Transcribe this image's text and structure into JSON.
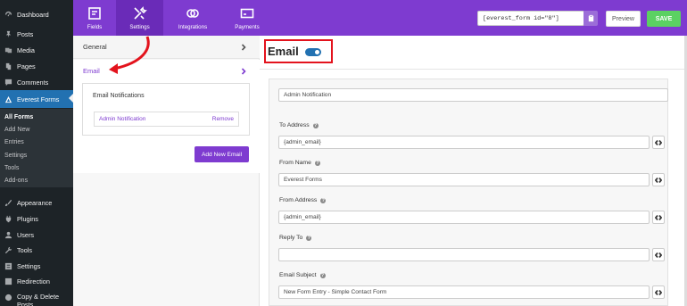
{
  "wp_menu": {
    "items": [
      {
        "label": "Dashboard",
        "icon": "dashboard-icon"
      },
      {
        "label": "Posts",
        "icon": "pin-icon"
      },
      {
        "label": "Media",
        "icon": "media-icon"
      },
      {
        "label": "Pages",
        "icon": "pages-icon"
      },
      {
        "label": "Comments",
        "icon": "comment-icon"
      },
      {
        "label": "Everest Forms",
        "icon": "everest-forms-icon"
      },
      {
        "label": "Appearance",
        "icon": "brush-icon"
      },
      {
        "label": "Plugins",
        "icon": "plugin-icon"
      },
      {
        "label": "Users",
        "icon": "users-icon"
      },
      {
        "label": "Tools",
        "icon": "wrench-icon"
      },
      {
        "label": "Settings",
        "icon": "settings-icon"
      },
      {
        "label": "Redirection",
        "icon": "redirection-icon"
      },
      {
        "label": "Copy & Delete Posts",
        "icon": "copy-icon"
      }
    ],
    "submenu": [
      "All Forms",
      "Add New",
      "Entries",
      "Settings",
      "Tools",
      "Add-ons"
    ]
  },
  "topbar": {
    "tabs": [
      {
        "label": "Fields",
        "icon": "fields-icon"
      },
      {
        "label": "Settings",
        "icon": "settings-tools-icon"
      },
      {
        "label": "Integrations",
        "icon": "integrations-icon"
      },
      {
        "label": "Payments",
        "icon": "payments-icon"
      }
    ],
    "shortcode": "[everest_form id=\"8\"]",
    "preview_label": "Preview",
    "save_label": "SAVE",
    "colors": {
      "brand": "#7e3bd0",
      "save": "#5bd162"
    }
  },
  "left_panel": {
    "general_label": "General",
    "email_label": "Email",
    "notifications_title": "Email Notifications",
    "notification_item": "Admin Notification",
    "remove_label": "Remove",
    "add_new_label": "Add New Email"
  },
  "main": {
    "title": "Email",
    "enabled": true,
    "notification_name": "Admin Notification",
    "fields": [
      {
        "label": "To Address",
        "value": "{admin_email}",
        "help": true
      },
      {
        "label": "From Name",
        "value": "Everest Forms",
        "help": true
      },
      {
        "label": "From Address",
        "value": "{admin_email}",
        "help": true
      },
      {
        "label": "Reply To",
        "value": "",
        "help": true
      },
      {
        "label": "Email Subject",
        "value": "New Form Entry  - Simple Contact Form",
        "help": true
      }
    ],
    "help_glyph": "?"
  }
}
